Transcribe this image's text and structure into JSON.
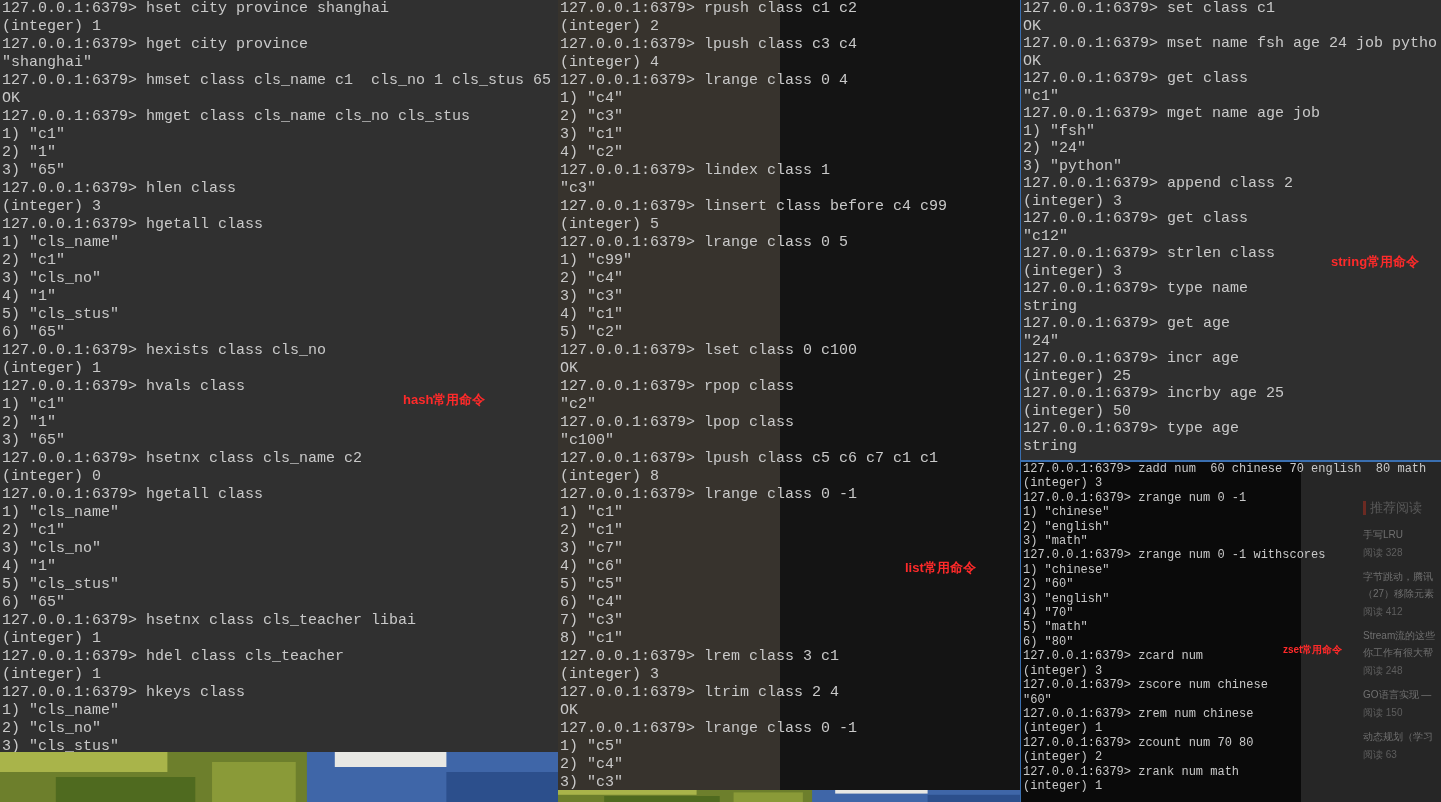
{
  "terminals": [
    {
      "kind": "hash",
      "label": "hash常用命令",
      "lines": [
        "127.0.0.1:6379> hset city province shanghai",
        "(integer) 1",
        "127.0.0.1:6379> hget city province",
        "\"shanghai\"",
        "127.0.0.1:6379> hmset class cls_name c1  cls_no 1 cls_stus 65",
        "OK",
        "127.0.0.1:6379> hmget class cls_name cls_no cls_stus",
        "1) \"c1\"",
        "2) \"1\"",
        "3) \"65\"",
        "127.0.0.1:6379> hlen class",
        "(integer) 3",
        "127.0.0.1:6379> hgetall class",
        "1) \"cls_name\"",
        "2) \"c1\"",
        "3) \"cls_no\"",
        "4) \"1\"",
        "5) \"cls_stus\"",
        "6) \"65\"",
        "127.0.0.1:6379> hexists class cls_no",
        "(integer) 1",
        "127.0.0.1:6379> hvals class",
        "1) \"c1\"",
        "2) \"1\"",
        "3) \"65\"",
        "127.0.0.1:6379> hsetnx class cls_name c2",
        "(integer) 0",
        "127.0.0.1:6379> hgetall class",
        "1) \"cls_name\"",
        "2) \"c1\"",
        "3) \"cls_no\"",
        "4) \"1\"",
        "5) \"cls_stus\"",
        "6) \"65\"",
        "127.0.0.1:6379> hsetnx class cls_teacher libai",
        "(integer) 1",
        "127.0.0.1:6379> hdel class cls_teacher",
        "(integer) 1",
        "127.0.0.1:6379> hkeys class",
        "1) \"cls_name\"",
        "2) \"cls_no\"",
        "3) \"cls_stus\""
      ]
    },
    {
      "kind": "list",
      "label": "list常用命令",
      "lines": [
        "127.0.0.1:6379> rpush class c1 c2",
        "(integer) 2",
        "127.0.0.1:6379> lpush class c3 c4",
        "(integer) 4",
        "127.0.0.1:6379> lrange class 0 4",
        "1) \"c4\"",
        "2) \"c3\"",
        "3) \"c1\"",
        "4) \"c2\"",
        "127.0.0.1:6379> lindex class 1",
        "\"c3\"",
        "127.0.0.1:6379> linsert class before c4 c99",
        "(integer) 5",
        "127.0.0.1:6379> lrange class 0 5",
        "1) \"c99\"",
        "2) \"c4\"",
        "3) \"c3\"",
        "4) \"c1\"",
        "5) \"c2\"",
        "127.0.0.1:6379> lset class 0 c100",
        "OK",
        "127.0.0.1:6379> rpop class",
        "\"c2\"",
        "127.0.0.1:6379> lpop class",
        "\"c100\"",
        "127.0.0.1:6379> lpush class c5 c6 c7 c1 c1",
        "(integer) 8",
        "127.0.0.1:6379> lrange class 0 -1",
        "1) \"c1\"",
        "2) \"c1\"",
        "3) \"c7\"",
        "4) \"c6\"",
        "5) \"c5\"",
        "6) \"c4\"",
        "7) \"c3\"",
        "8) \"c1\"",
        "127.0.0.1:6379> lrem class 3 c1",
        "(integer) 3",
        "127.0.0.1:6379> ltrim class 2 4",
        "OK",
        "127.0.0.1:6379> lrange class 0 -1",
        "1) \"c5\"",
        "2) \"c4\"",
        "3) \"c3\""
      ]
    },
    {
      "kind": "string",
      "label": "string常用命令",
      "lines": [
        "127.0.0.1:6379> set class c1",
        "OK",
        "127.0.0.1:6379> mset name fsh age 24 job pytho",
        "OK",
        "127.0.0.1:6379> get class",
        "\"c1\"",
        "127.0.0.1:6379> mget name age job",
        "1) \"fsh\"",
        "2) \"24\"",
        "3) \"python\"",
        "127.0.0.1:6379> append class 2",
        "(integer) 3",
        "127.0.0.1:6379> get class",
        "\"c12\"",
        "127.0.0.1:6379> strlen class",
        "(integer) 3",
        "127.0.0.1:6379> type name",
        "string",
        "127.0.0.1:6379> get age",
        "\"24\"",
        "127.0.0.1:6379> incr age",
        "(integer) 25",
        "127.0.0.1:6379> incrby age 25",
        "(integer) 50",
        "127.0.0.1:6379> type age",
        "string"
      ]
    },
    {
      "kind": "zset",
      "label": "zset常用命令",
      "lines": [
        "127.0.0.1:6379> zadd num  60 chinese 70 english  80 math",
        "(integer) 3",
        "127.0.0.1:6379> zrange num 0 -1",
        "1) \"chinese\"",
        "2) \"english\"",
        "3) \"math\"",
        "127.0.0.1:6379> zrange num 0 -1 withscores",
        "1) \"chinese\"",
        "2) \"60\"",
        "3) \"english\"",
        "4) \"70\"",
        "5) \"math\"",
        "6) \"80\"",
        "127.0.0.1:6379> zcard num",
        "(integer) 3",
        "127.0.0.1:6379> zscore num chinese",
        "\"60\"",
        "127.0.0.1:6379> zrem num chinese",
        "(integer) 1",
        "127.0.0.1:6379> zcount num 70 80",
        "(integer) 2",
        "127.0.0.1:6379> zrank num math",
        "(integer) 1"
      ]
    }
  ],
  "reading": {
    "title": "推荐阅读",
    "items": [
      {
        "lines": [
          "手写LRU"
        ],
        "count": "阅读 328"
      },
      {
        "lines": [
          "字节跳动，腾讯",
          "（27）移除元素"
        ],
        "count": "阅读 412"
      },
      {
        "lines": [
          "Stream流的这些",
          "你工作有很大帮"
        ],
        "count": "阅读 248"
      },
      {
        "lines": [
          "GO语言实现 —"
        ],
        "count": "阅读 150"
      },
      {
        "lines": [
          "动态规划（学习"
        ],
        "count": "阅读 63"
      }
    ]
  }
}
